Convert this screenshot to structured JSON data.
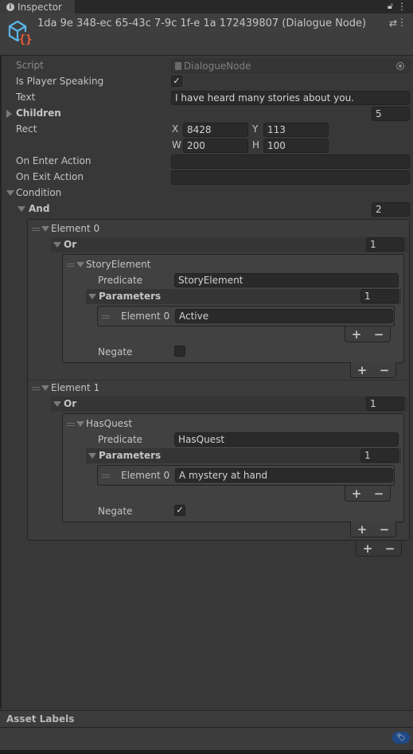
{
  "window": {
    "tab_label": "Inspector",
    "tab_icon": "info-icon",
    "lock_icon": "lock-icon",
    "menu_icon": "kebab-menu-icon"
  },
  "header": {
    "title": "1da 9e 348-ec 65-43c 7-9c 1f-e 1a 172439807 (Dialogue Node)",
    "object_icon": "scriptable-object-icon",
    "preset_icon": "preset-sliders-icon",
    "menu_icon": "kebab-menu-icon"
  },
  "fields": {
    "script": {
      "label": "Script",
      "value": "DialogueNode"
    },
    "is_player_speaking": {
      "label": "Is Player Speaking",
      "checked": true,
      "mark": "✓"
    },
    "text": {
      "label": "Text",
      "value": "I have heard many stories about you."
    },
    "children": {
      "label": "Children",
      "count": "5",
      "expanded": false
    },
    "rect": {
      "label": "Rect",
      "x_label": "X",
      "x": "8428",
      "y_label": "Y",
      "y": "113",
      "w_label": "W",
      "w": "200",
      "h_label": "H",
      "h": "100"
    },
    "on_enter_action": {
      "label": "On Enter Action",
      "value": ""
    },
    "on_exit_action": {
      "label": "On Exit Action",
      "value": ""
    },
    "condition": {
      "label": "Condition",
      "expanded": true
    }
  },
  "and": {
    "label": "And",
    "count": "2",
    "elements": [
      {
        "label": "Element 0",
        "or_label": "Or",
        "or_count": "1",
        "predicate_block": {
          "title": "StoryElement",
          "predicate_label": "Predicate",
          "predicate_value": "StoryElement",
          "parameters_label": "Parameters",
          "parameters_count": "1",
          "param_label": "Element 0",
          "param_value": "Active",
          "negate_label": "Negate",
          "negate": false,
          "negate_mark": ""
        }
      },
      {
        "label": "Element 1",
        "or_label": "Or",
        "or_count": "1",
        "predicate_block": {
          "title": "HasQuest",
          "predicate_label": "Predicate",
          "predicate_value": "HasQuest",
          "parameters_label": "Parameters",
          "parameters_count": "1",
          "param_label": "Element 0",
          "param_value": "A mystery at hand",
          "negate_label": "Negate",
          "negate": true,
          "negate_mark": "✓"
        }
      }
    ]
  },
  "list_buttons": {
    "add": "+",
    "remove": "−"
  },
  "asset_labels": {
    "title": "Asset Labels",
    "tag_icon": "tag-icon"
  },
  "colors": {
    "accent": "#1f4a87",
    "background": "#383838",
    "field": "#2a2a2a"
  }
}
